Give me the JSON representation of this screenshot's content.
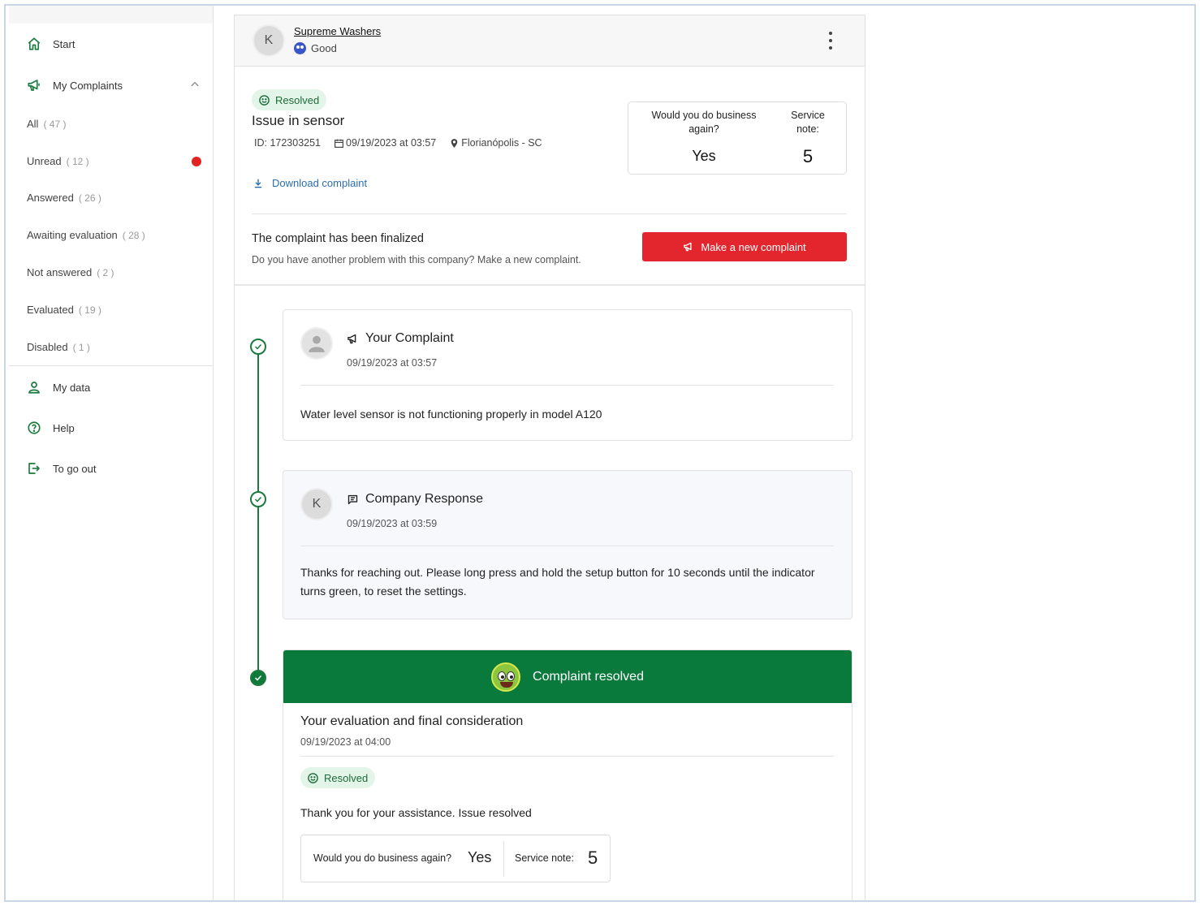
{
  "sidebar": {
    "start": "Start",
    "my_complaints": "My Complaints",
    "filters": [
      {
        "label": "All",
        "count": "( 47 )"
      },
      {
        "label": "Unread",
        "count": "( 12 )"
      },
      {
        "label": "Answered",
        "count": "( 26 )"
      },
      {
        "label": "Awaiting evaluation",
        "count": "( 28 )"
      },
      {
        "label": "Not answered",
        "count": "( 2 )"
      },
      {
        "label": "Evaluated",
        "count": "( 19 )"
      },
      {
        "label": "Disabled",
        "count": "( 1 )"
      }
    ],
    "my_data": "My data",
    "help": "Help",
    "logout": "To go out"
  },
  "company": {
    "avatar_letter": "K",
    "name": "Supreme Washers",
    "reputation": "Good"
  },
  "complaint": {
    "status": "Resolved",
    "title": "Issue in sensor",
    "id": "ID: 172303251",
    "date": "09/19/2023 at 03:57",
    "location": "Florianópolis - SC",
    "download_label": "Download complaint",
    "evaluation": {
      "business_again_q": "Would you do business again?",
      "business_again_a": "Yes",
      "service_note_q": "Service note:",
      "service_note_a": "5"
    },
    "finalized_title": "The complaint has been finalized",
    "finalized_sub": "Do you have another problem with this company? Make a new complaint.",
    "new_complaint_button": "Make a new complaint"
  },
  "timeline": {
    "your_complaint": {
      "title": "Your Complaint",
      "date": "09/19/2023 at 03:57",
      "text": "Water level sensor is not functioning properly in model A120"
    },
    "company_response": {
      "avatar_letter": "K",
      "title": "Company Response",
      "date": "09/19/2023 at 03:59",
      "text": "Thanks for reaching out. Please long press and hold the setup button for 10 seconds until the indicator turns green, to reset the settings."
    },
    "resolved": {
      "banner": "Complaint resolved",
      "title": "Your evaluation and final consideration",
      "date": "09/19/2023 at 04:00",
      "status": "Resolved",
      "text": "Thank you for your assistance. Issue resolved",
      "business_again_q": "Would you do business again?",
      "business_again_a": "Yes",
      "service_note_q": "Service note:",
      "service_note_a": "5"
    }
  },
  "colors": {
    "brand_green": "#1b7a3d",
    "banner_green": "#0a7a3c",
    "danger_red": "#e3262e",
    "link_blue": "#2a6fb3",
    "badge_bg": "#e3f5e9"
  }
}
